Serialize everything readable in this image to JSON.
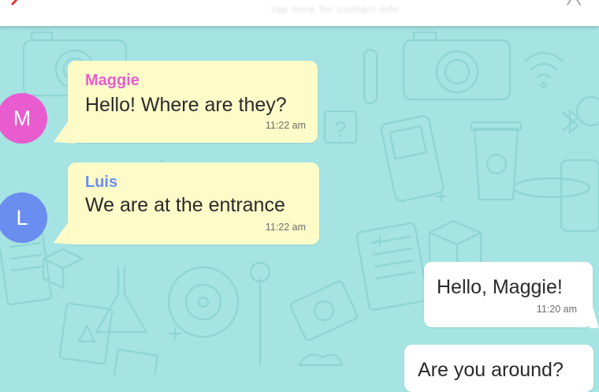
{
  "colors": {
    "background": "#a6e3e3",
    "incoming_bubble": "#fdfcc9",
    "outgoing_bubble": "#ffffff",
    "maggie": "#e85ccf",
    "luis": "#6a8df0",
    "accent_red": "#e53935"
  },
  "header": {
    "back_icon": "chevron-left-icon",
    "right_icon": "person-icon",
    "subtitle": "tap here for contact info"
  },
  "messages": [
    {
      "direction": "incoming",
      "sender": "Maggie",
      "avatar_initial": "M",
      "text": "Hello! Where are they?",
      "time": "11:22 am"
    },
    {
      "direction": "incoming",
      "sender": "Luis",
      "avatar_initial": "L",
      "text": "We are at the entrance",
      "time": "11:22 am"
    },
    {
      "direction": "outgoing",
      "text": "Hello, Maggie!",
      "time": "11:20 am"
    },
    {
      "direction": "outgoing",
      "text": "Are you around?"
    }
  ]
}
